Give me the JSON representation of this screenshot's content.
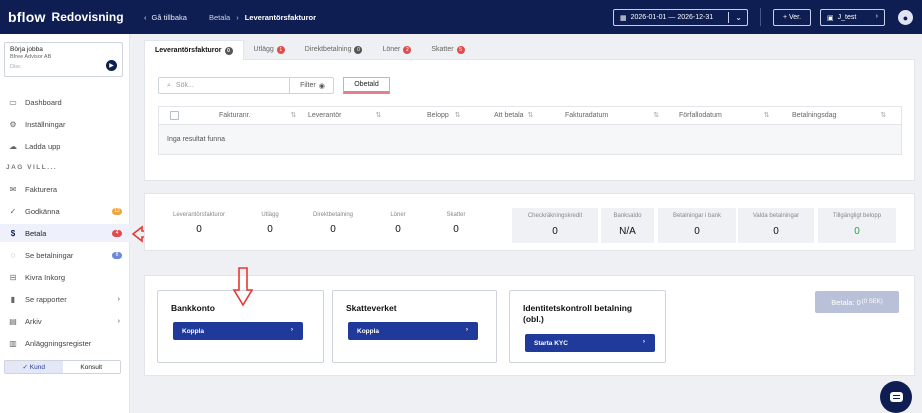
{
  "topbar": {
    "logo": "bflow",
    "product": "Redovisning",
    "back_label": "Gå tillbaka",
    "breadcrumb": [
      "Betala",
      "Leverantörsfakturor"
    ],
    "date_range": "2026-01-01 — 2026-12-31",
    "ver_label": "+ Ver.",
    "user_label": "J_test"
  },
  "company": {
    "title": "Börja jobba",
    "subtitle": "Bfree Advisor AB",
    "placeholder": "Disc"
  },
  "sidebar": {
    "items_top": [
      {
        "label": "Dashboard",
        "icon": "monitor-icon"
      },
      {
        "label": "Inställningar",
        "icon": "gear-icon"
      },
      {
        "label": "Ladda upp",
        "icon": "cloud-upload-icon"
      }
    ],
    "section_title": "JAG VILL...",
    "items": [
      {
        "label": "Fakturera",
        "icon": "mail-icon",
        "badge": ""
      },
      {
        "label": "Godkänna",
        "icon": "check-icon",
        "badge": "12"
      },
      {
        "label": "Betala",
        "icon": "dollar-icon",
        "badge": "4"
      },
      {
        "label": "Se betalningar",
        "icon": "check-circle-icon",
        "badge": "8"
      },
      {
        "label": "Kivra Inkorg",
        "icon": "inbox-icon",
        "badge": ""
      },
      {
        "label": "Se rapporter",
        "icon": "bar-chart-icon",
        "badge": ""
      },
      {
        "label": "Arkiv",
        "icon": "archive-icon",
        "badge": ""
      },
      {
        "label": "Anläggningsregister",
        "icon": "files-icon",
        "badge": ""
      }
    ],
    "toggle": {
      "left": "✓ Kund",
      "right": "Konsult"
    }
  },
  "tabs": [
    {
      "label": "Leverantörsfakturor",
      "count": "0",
      "color": "#555555"
    },
    {
      "label": "Utlägg",
      "count": "1",
      "color": "#e04c4c"
    },
    {
      "label": "Direktbetalning",
      "count": "0",
      "color": "#555555"
    },
    {
      "label": "Löner",
      "count": "2",
      "color": "#e04c4c"
    },
    {
      "label": "Skatter",
      "count": "5",
      "color": "#e04c4c"
    }
  ],
  "filters": {
    "search_placeholder": "Sök...",
    "filter_label": "Filter",
    "obetald_label": "Obetald"
  },
  "table": {
    "columns": [
      "Fakturanr.",
      "Leverantör",
      "Belopp",
      "Att betala",
      "Fakturadatum",
      "Förfallodatum",
      "Betalningsdag"
    ],
    "empty_text": "Inga resultat funna"
  },
  "stats": {
    "left": [
      {
        "label": "Leverantörsfakturor",
        "value": "0"
      },
      {
        "label": "Utlägg",
        "value": "0"
      },
      {
        "label": "Direktbetalning",
        "value": "0"
      },
      {
        "label": "Löner",
        "value": "0"
      },
      {
        "label": "Skatter",
        "value": "0"
      }
    ],
    "right": [
      {
        "label": "Checkräkningskredit",
        "value": "0"
      },
      {
        "label": "Banksaldo",
        "value": "N/A"
      },
      {
        "label": "Betalningar i bank",
        "value": "0"
      },
      {
        "label": "Valda betalningar",
        "value": "0"
      },
      {
        "label": "Tillgängligt belopp",
        "value": "0"
      }
    ]
  },
  "payment_boxes": [
    {
      "title": "Bankkonto",
      "button": "Koppla"
    },
    {
      "title": "Skatteverket",
      "button": "Koppla"
    },
    {
      "title": "Identitetskontroll betalning (obl.)",
      "button": "Starta KYC"
    }
  ],
  "betala": {
    "label": "Betala: 0",
    "sub": "(0 SEK)"
  }
}
